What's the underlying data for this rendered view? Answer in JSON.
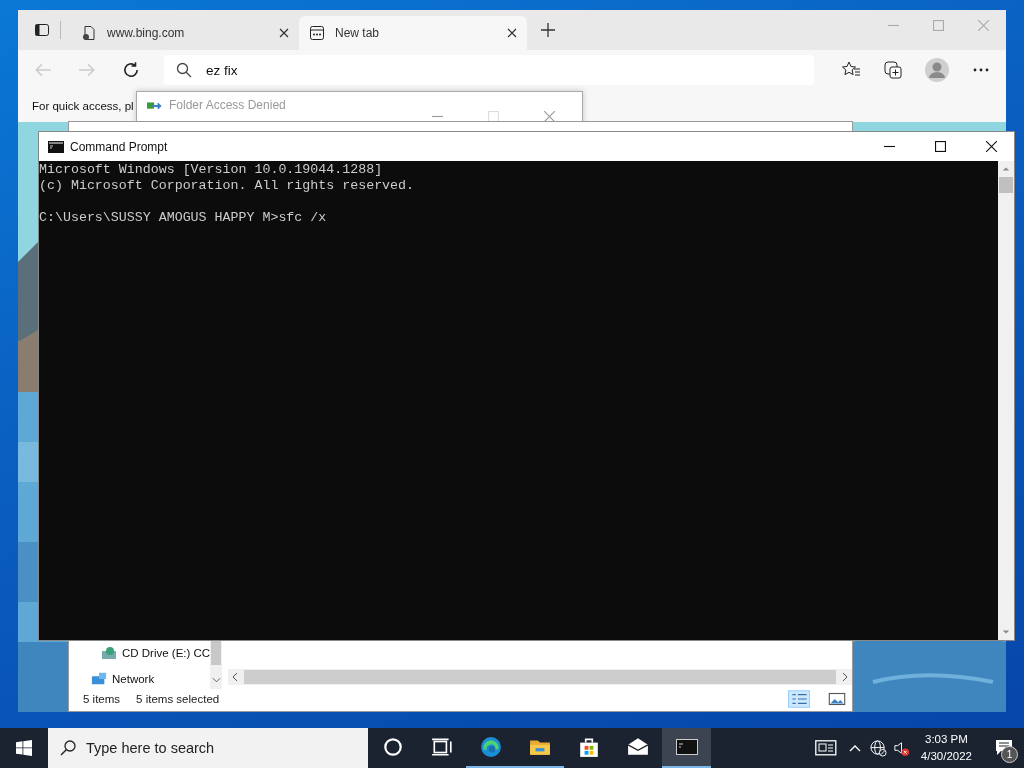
{
  "browser": {
    "tabs": [
      {
        "title": "www.bing.com",
        "selected": false
      },
      {
        "title": "New tab",
        "selected": true
      }
    ],
    "address": {
      "value": "ez fix"
    },
    "hint": "For quick access, pl"
  },
  "dialog": {
    "title": "Folder Access Denied"
  },
  "explorer": {
    "nav_items": [
      {
        "kind": "drive",
        "label": "CD Drive (E:) CC"
      },
      {
        "kind": "network",
        "label": "Network"
      }
    ],
    "status": [
      "5 items",
      "5 items selected"
    ]
  },
  "console": {
    "title": "Command Prompt",
    "output": [
      "Microsoft Windows [Version 10.0.19044.1288]",
      "(c) Microsoft Corporation. All rights reserved."
    ],
    "prompt_line": "C:\\Users\\SUSSY AMOGUS HAPPY M>sfc /x"
  },
  "taskbar": {
    "search": {
      "placeholder": "Type here to search"
    },
    "apps": [
      {
        "kind": "cortana",
        "running": false,
        "selected": false
      },
      {
        "kind": "taskview",
        "running": false,
        "selected": false
      },
      {
        "kind": "edge",
        "running": true,
        "selected": false
      },
      {
        "kind": "folder",
        "running": true,
        "selected": false
      },
      {
        "kind": "store",
        "running": false,
        "selected": false
      },
      {
        "kind": "mail",
        "running": false,
        "selected": false
      },
      {
        "kind": "terminal",
        "running": true,
        "selected": true
      }
    ],
    "clock": {
      "time": "3:03 PM",
      "date": "4/30/2022"
    },
    "notifications": "1"
  }
}
